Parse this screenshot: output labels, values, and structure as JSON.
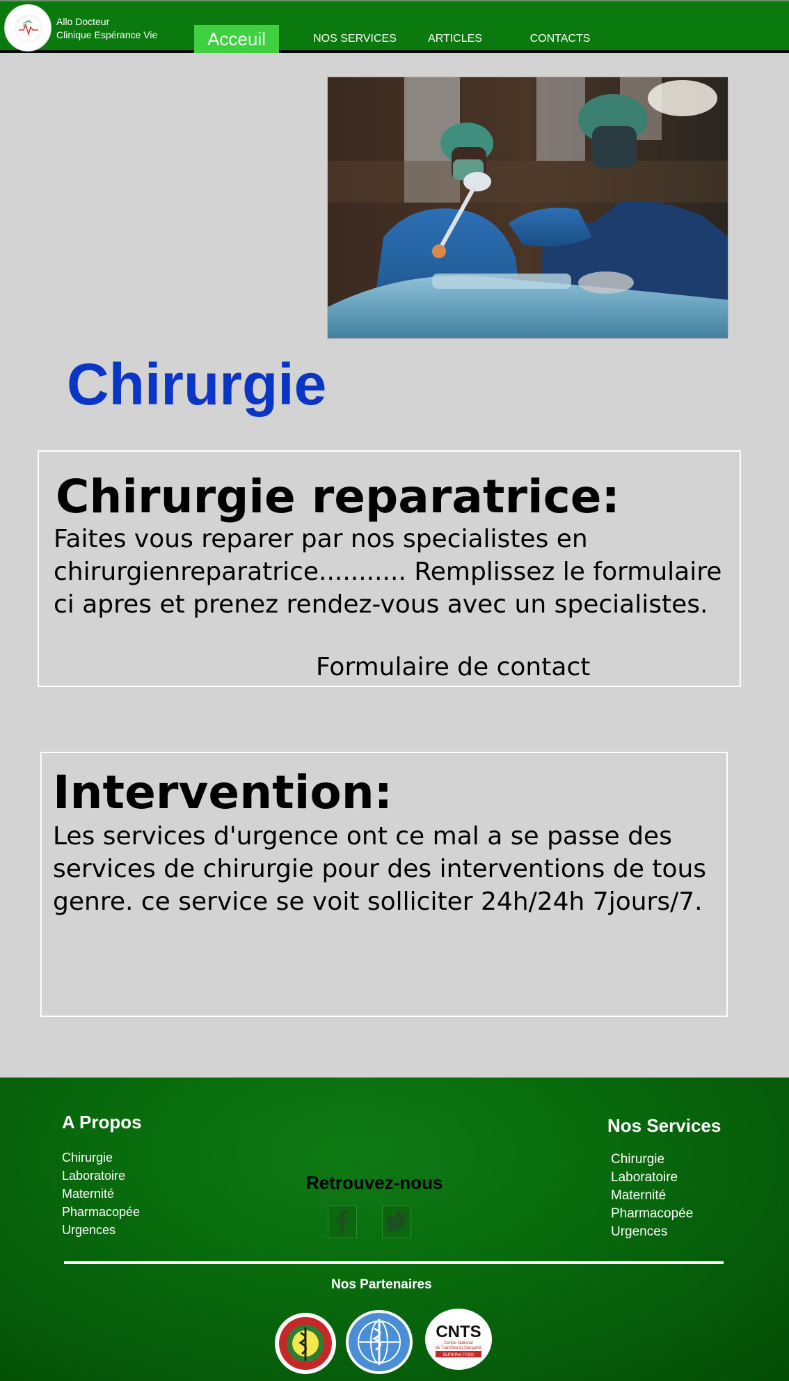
{
  "header": {
    "brand_line1": "Allo Docteur",
    "brand_line2": "Clinique Espérance Vie",
    "logo_icon": "clinic-logo-icon",
    "nav": [
      {
        "label": "Acceuil",
        "active": true
      },
      {
        "label": "NOS SERVICES"
      },
      {
        "label": "ARTICLES"
      },
      {
        "label": "CONTACTS"
      }
    ]
  },
  "main": {
    "title": "Chirurgie",
    "sections": [
      {
        "heading": "Chirurgie reparatrice:",
        "text": "Faites vous reparer par nos specialistes en chirurgienreparatrice........... Remplissez le formulaire ci apres et prenez rendez-vous avec un specialistes.",
        "link": "Formulaire de contact"
      },
      {
        "heading": "Intervention:",
        "text": "Les services d'urgence ont ce mal a se passe des services de chirurgie pour des interventions de tous genre. ce service se voit solliciter 24h/24h 7jours/7."
      }
    ]
  },
  "footer": {
    "about": {
      "title": "A Propos",
      "items": [
        "Chirurgie",
        "Laboratoire",
        "Maternité",
        "Pharmacopée",
        "Urgences"
      ]
    },
    "social": {
      "title": "Retrouvez-nous",
      "icons": [
        "facebook-icon",
        "twitter-icon"
      ]
    },
    "services": {
      "title": "Nos Services",
      "items": [
        "Chirurgie",
        "Laboratoire",
        "Maternité",
        "Pharmacopée",
        "Urgences"
      ]
    },
    "partners": {
      "title": "Nos Partenaires",
      "logos": [
        {
          "name": "health-ministry-logo"
        },
        {
          "name": "who-logo"
        },
        {
          "name": "cnts-logo",
          "line1": "CNTS",
          "line2": "Centre National",
          "line3": "de Transfusion Sanguine",
          "line4": "BURKINA FASO"
        }
      ]
    }
  },
  "colors": {
    "header_green": "#0b7a0e",
    "active_nav": "#3fd03f",
    "title_blue": "#0a35c5",
    "page_bg": "#d3d3d3"
  }
}
